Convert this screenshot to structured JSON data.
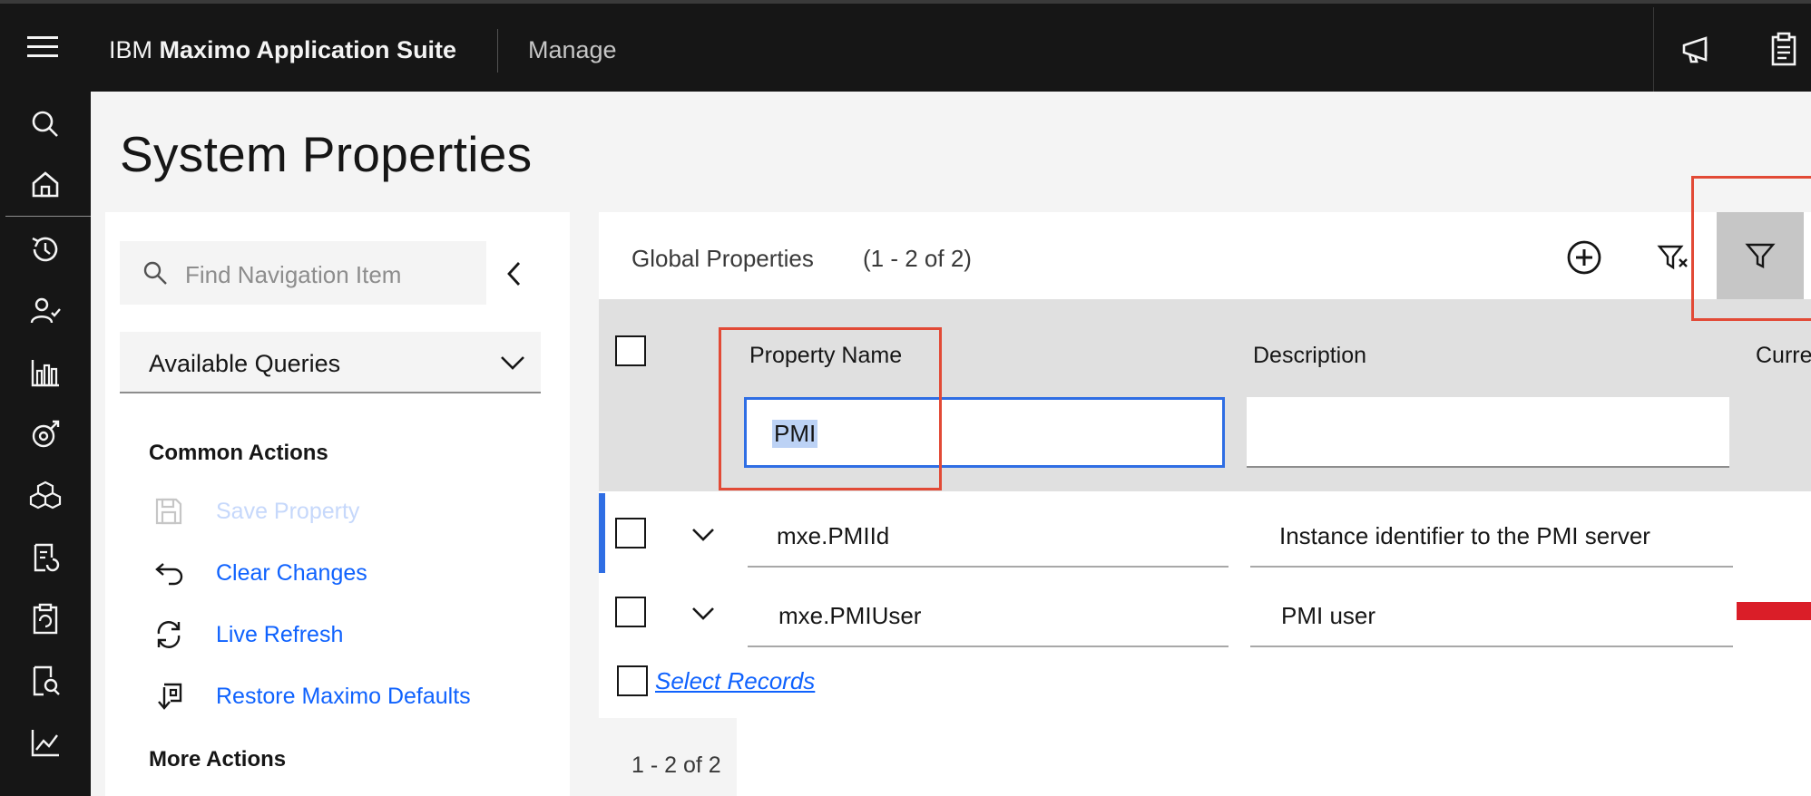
{
  "header": {
    "brand_prefix": "IBM",
    "brand_name": "Maximo Application Suite",
    "app_name": "Manage",
    "icons": [
      "menu-icon",
      "announcement-icon",
      "clipboard-icon"
    ]
  },
  "rail": {
    "icons": [
      "search-icon",
      "home-icon",
      "recent-history-icon",
      "user-check-icon",
      "chart-bar-icon",
      "asset-icon",
      "cube-icon",
      "work-order-icon",
      "clipboard-refresh-icon",
      "document-search-icon",
      "line-chart-icon"
    ]
  },
  "page": {
    "title": "System Properties"
  },
  "nav": {
    "search_placeholder": "Find Navigation Item",
    "queries_label": "Available Queries",
    "common_actions_title": "Common Actions",
    "actions": [
      {
        "label": "Save Property",
        "icon": "save-icon",
        "enabled": false
      },
      {
        "label": "Clear Changes",
        "icon": "undo-icon",
        "enabled": true
      },
      {
        "label": "Live Refresh",
        "icon": "refresh-icon",
        "enabled": true
      },
      {
        "label": "Restore Maximo Defaults",
        "icon": "restore-icon",
        "enabled": true
      }
    ],
    "more_actions_title": "More Actions"
  },
  "table": {
    "title": "Global Properties",
    "count": "(1 - 2 of 2)",
    "columns": [
      "Property Name",
      "Description",
      "Curre"
    ],
    "filter": {
      "property_name": "PMI",
      "description": ""
    },
    "rows": [
      {
        "name": "mxe.PMIId",
        "description": "Instance identifier to the PMI server"
      },
      {
        "name": "mxe.PMIUser",
        "description": "PMI user"
      }
    ],
    "select_records_label": "Select Records",
    "pager": "1 - 2 of 2"
  },
  "colors": {
    "header_bg": "#161616",
    "link": "#0f62fe",
    "focus": "#2f6ee4",
    "highlight": "#e24a36"
  }
}
